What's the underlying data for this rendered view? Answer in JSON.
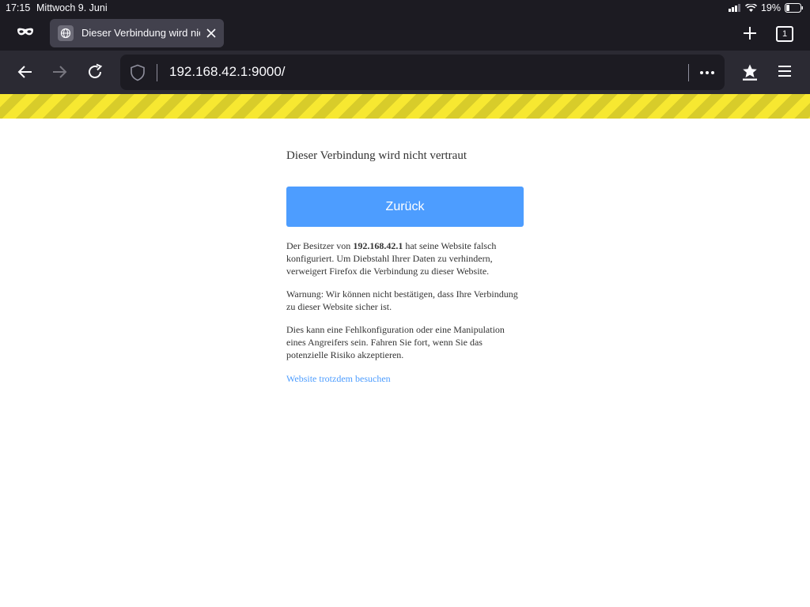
{
  "status_bar": {
    "time": "17:15",
    "date": "Mittwoch 9. Juni",
    "battery": "19%"
  },
  "tab": {
    "title": "Dieser Verbindung wird nicht vertraut",
    "count": "1"
  },
  "toolbar": {
    "url": "192.168.42.1:9000/"
  },
  "page": {
    "heading": "Dieser Verbindung wird nicht vertraut",
    "back_button": "Zurück",
    "p1_before": "Der Besitzer von ",
    "p1_host": "192.168.42.1",
    "p1_after": " hat seine Website falsch konfiguriert. Um Diebstahl Ihrer Daten zu verhindern, verweigert Firefox die Verbindung zu dieser Website.",
    "p2": "Warnung: Wir können nicht bestätigen, dass Ihre Verbindung zu dieser Website sicher ist.",
    "p3": "Dies kann eine Fehlkonfiguration oder eine Manipulation eines Angreifers sein. Fahren Sie fort, wenn Sie das potenzielle Risiko akzeptieren.",
    "visit_link": "Website trotzdem besuchen"
  },
  "colors": {
    "accent": "#4d9dff",
    "chrome_dark": "#1c1b22",
    "toolbar": "#2b2a33",
    "stripe_yellow": "#f7e831"
  },
  "icons": [
    "private-mask-icon",
    "globe-icon",
    "close-icon",
    "plus-icon",
    "tab-count-icon",
    "back-arrow-icon",
    "forward-arrow-icon",
    "reload-icon",
    "shield-icon",
    "more-icon",
    "bookmark-star-icon",
    "menu-icon",
    "signal-icon",
    "wifi-icon",
    "battery-icon"
  ]
}
